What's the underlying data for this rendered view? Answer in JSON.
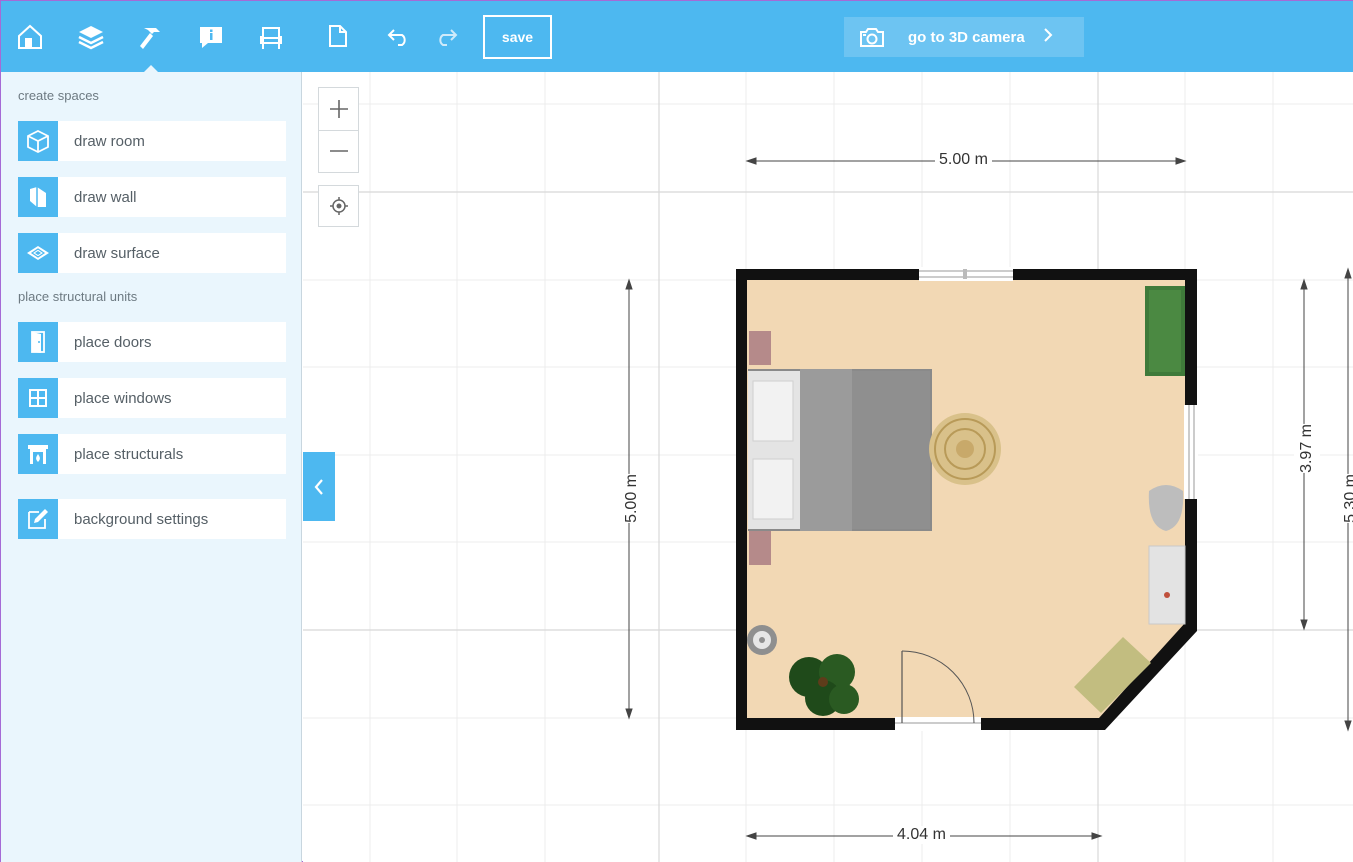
{
  "top_icons": [
    {
      "name": "home-icon"
    },
    {
      "name": "layers-icon"
    },
    {
      "name": "hammer-icon"
    },
    {
      "name": "info-icon"
    },
    {
      "name": "chair-icon"
    }
  ],
  "sidebar": {
    "section_create": "create spaces",
    "section_place": "place structural units",
    "items": [
      {
        "label": "draw room",
        "icon": "room-cube-icon"
      },
      {
        "label": "draw wall",
        "icon": "wall-icon"
      },
      {
        "label": "draw surface",
        "icon": "surface-icon"
      },
      {
        "label": "place doors",
        "icon": "door-icon"
      },
      {
        "label": "place windows",
        "icon": "window-icon"
      },
      {
        "label": "place structurals",
        "icon": "fireplace-icon"
      },
      {
        "label": "background settings",
        "icon": "edit-icon"
      }
    ]
  },
  "toolbar": {
    "save_label": "save",
    "camera_label": "go to 3D camera"
  },
  "dimensions": {
    "top_width": "5.00 m",
    "bottom_width": "4.04 m",
    "left_height": "5.00 m",
    "right_inner_height": "3.97 m",
    "right_outer_height": "5.30 m"
  },
  "colors": {
    "accent": "#4db8f0",
    "sidebar_bg": "#eaf6fd",
    "floor": "#f2d8b4",
    "wall": "#111111"
  }
}
